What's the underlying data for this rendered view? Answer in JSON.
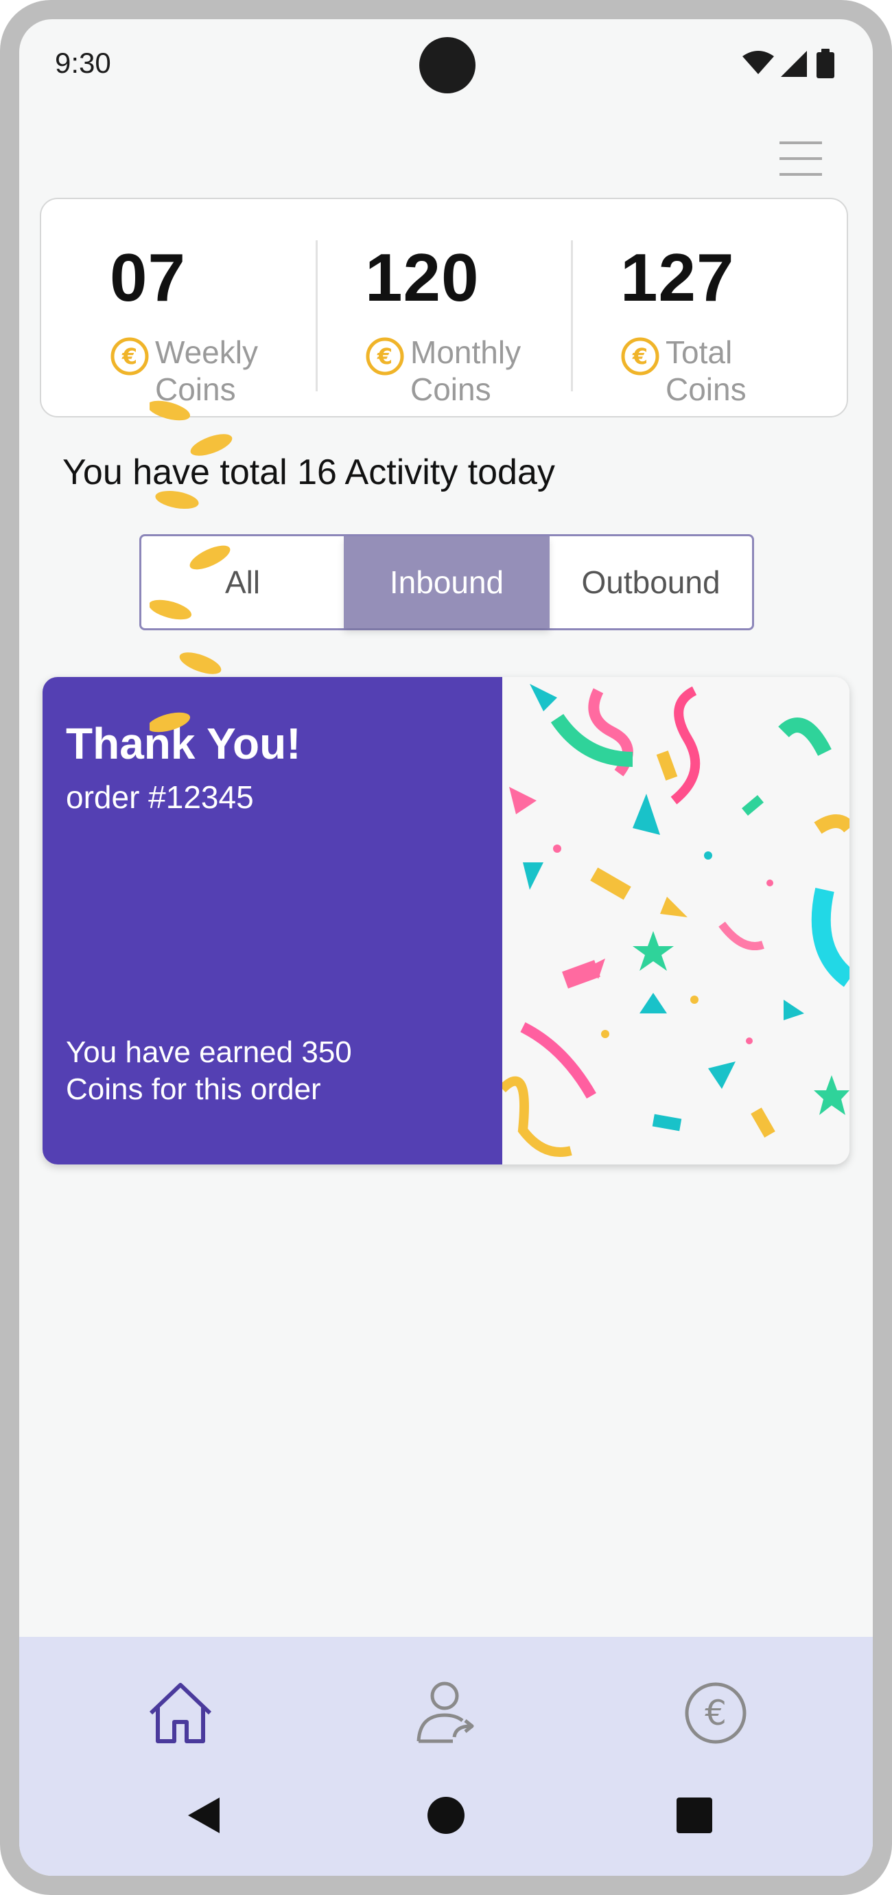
{
  "status_bar": {
    "time": "9:30"
  },
  "stats": [
    {
      "value": "07",
      "label": "Weekly Coins"
    },
    {
      "value": "120",
      "label": "Monthly Coins"
    },
    {
      "value": "127",
      "label": "Total Coins"
    }
  ],
  "coin_symbol": "€",
  "activity_text": "You have total 16 Activity today",
  "tabs": [
    {
      "label": "All",
      "active": false
    },
    {
      "label": "Inbound",
      "active": true
    },
    {
      "label": "Outbound",
      "active": false
    }
  ],
  "card": {
    "title": "Thank You!",
    "order": "order #12345",
    "earned": "You have earned 350 Coins for this order"
  },
  "colors": {
    "accent": "#5440b3",
    "tab_active": "#958fb8",
    "coin": "#f0b429",
    "bottom_bar": "#dde0f4"
  },
  "icons": [
    "menu-icon",
    "coin-icon",
    "home-icon",
    "user-transfer-icon",
    "euro-icon",
    "back-icon",
    "home-circle-icon",
    "recents-icon"
  ]
}
